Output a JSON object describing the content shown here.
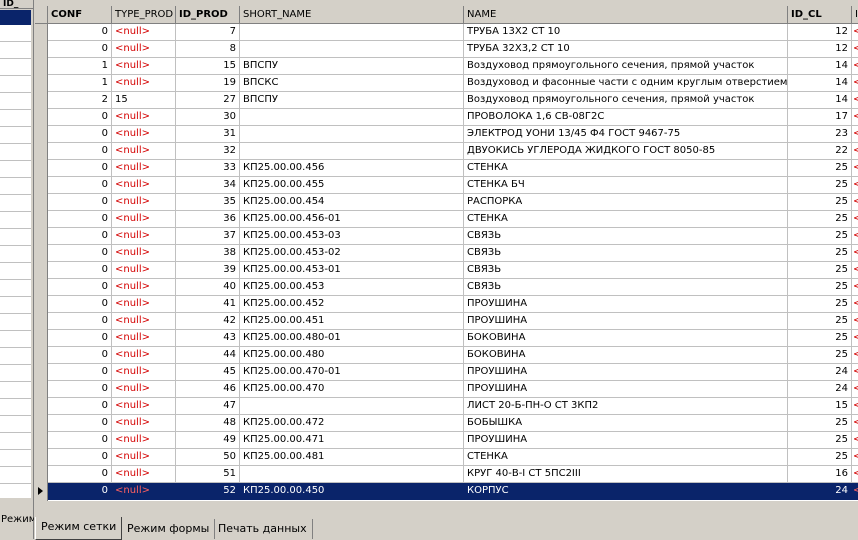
{
  "left": {
    "header": "ID_",
    "tab_label": "Режим"
  },
  "columns": [
    {
      "key": "conf",
      "label": "CONF",
      "bold": true
    },
    {
      "key": "type_prod",
      "label": "TYPE_PROD",
      "bold": false
    },
    {
      "key": "id_prod",
      "label": "ID_PROD",
      "bold": true
    },
    {
      "key": "short_name",
      "label": "SHORT_NAME",
      "bold": false
    },
    {
      "key": "name",
      "label": "NAME",
      "bold": false
    },
    {
      "key": "id_cl",
      "label": "ID_CL",
      "bold": true
    },
    {
      "key": "extra",
      "label": "I",
      "bold": false
    }
  ],
  "null_text": "<null>",
  "rows": [
    {
      "conf": "0",
      "type_prod": null,
      "id_prod": "7",
      "short_name": "",
      "name": "ТРУБА 13Х2 СТ 10",
      "id_cl": "12"
    },
    {
      "conf": "0",
      "type_prod": null,
      "id_prod": "8",
      "short_name": "",
      "name": "ТРУБА 32Х3,2 СТ 10",
      "id_cl": "12"
    },
    {
      "conf": "1",
      "type_prod": null,
      "id_prod": "15",
      "short_name": "ВПСПУ",
      "name": "Воздуховод прямоугольного сечения, прямой участок",
      "id_cl": "14"
    },
    {
      "conf": "1",
      "type_prod": null,
      "id_prod": "19",
      "short_name": "ВПСКС",
      "name": "Воздуховод и фасонные части с одним круглым отверстием",
      "id_cl": "14"
    },
    {
      "conf": "2",
      "type_prod": "15",
      "id_prod": "27",
      "short_name": "ВПСПУ",
      "name": "Воздуховод прямоугольного сечения, прямой участок",
      "id_cl": "14"
    },
    {
      "conf": "0",
      "type_prod": null,
      "id_prod": "30",
      "short_name": "",
      "name": "ПРОВОЛОКА 1,6 СВ-08Г2С",
      "id_cl": "17"
    },
    {
      "conf": "0",
      "type_prod": null,
      "id_prod": "31",
      "short_name": "",
      "name": "ЭЛЕКТРОД УОНИ 13/45 Ф4 ГОСТ 9467-75",
      "id_cl": "23"
    },
    {
      "conf": "0",
      "type_prod": null,
      "id_prod": "32",
      "short_name": "",
      "name": "ДВУОКИСЬ УГЛЕРОДА ЖИДКОГО ГОСТ 8050-85",
      "id_cl": "22"
    },
    {
      "conf": "0",
      "type_prod": null,
      "id_prod": "33",
      "short_name": "КП25.00.00.456",
      "name": "СТЕНКА",
      "id_cl": "25"
    },
    {
      "conf": "0",
      "type_prod": null,
      "id_prod": "34",
      "short_name": "КП25.00.00.455",
      "name": "СТЕНКА БЧ",
      "id_cl": "25"
    },
    {
      "conf": "0",
      "type_prod": null,
      "id_prod": "35",
      "short_name": "КП25.00.00.454",
      "name": "РАСПОРКА",
      "id_cl": "25"
    },
    {
      "conf": "0",
      "type_prod": null,
      "id_prod": "36",
      "short_name": "КП25.00.00.456-01",
      "name": "СТЕНКА",
      "id_cl": "25"
    },
    {
      "conf": "0",
      "type_prod": null,
      "id_prod": "37",
      "short_name": "КП25.00.00.453-03",
      "name": "СВЯЗЬ",
      "id_cl": "25"
    },
    {
      "conf": "0",
      "type_prod": null,
      "id_prod": "38",
      "short_name": "КП25.00.00.453-02",
      "name": "СВЯЗЬ",
      "id_cl": "25"
    },
    {
      "conf": "0",
      "type_prod": null,
      "id_prod": "39",
      "short_name": "КП25.00.00.453-01",
      "name": "СВЯЗЬ",
      "id_cl": "25"
    },
    {
      "conf": "0",
      "type_prod": null,
      "id_prod": "40",
      "short_name": "КП25.00.00.453",
      "name": "СВЯЗЬ",
      "id_cl": "25"
    },
    {
      "conf": "0",
      "type_prod": null,
      "id_prod": "41",
      "short_name": "КП25.00.00.452",
      "name": "ПРОУШИНА",
      "id_cl": "25"
    },
    {
      "conf": "0",
      "type_prod": null,
      "id_prod": "42",
      "short_name": "КП25.00.00.451",
      "name": "ПРОУШИНА",
      "id_cl": "25"
    },
    {
      "conf": "0",
      "type_prod": null,
      "id_prod": "43",
      "short_name": "КП25.00.00.480-01",
      "name": "БОКОВИНА",
      "id_cl": "25"
    },
    {
      "conf": "0",
      "type_prod": null,
      "id_prod": "44",
      "short_name": "КП25.00.00.480",
      "name": "БОКОВИНА",
      "id_cl": "25"
    },
    {
      "conf": "0",
      "type_prod": null,
      "id_prod": "45",
      "short_name": "КП25.00.00.470-01",
      "name": "ПРОУШИНА",
      "id_cl": "24"
    },
    {
      "conf": "0",
      "type_prod": null,
      "id_prod": "46",
      "short_name": "КП25.00.00.470",
      "name": "ПРОУШИНА",
      "id_cl": "24"
    },
    {
      "conf": "0",
      "type_prod": null,
      "id_prod": "47",
      "short_name": "",
      "name": "ЛИСТ 20-Б-ПН-О СТ 3КП2",
      "id_cl": "15"
    },
    {
      "conf": "0",
      "type_prod": null,
      "id_prod": "48",
      "short_name": "КП25.00.00.472",
      "name": "БОБЫШКА",
      "id_cl": "25"
    },
    {
      "conf": "0",
      "type_prod": null,
      "id_prod": "49",
      "short_name": "КП25.00.00.471",
      "name": "ПРОУШИНА",
      "id_cl": "25"
    },
    {
      "conf": "0",
      "type_prod": null,
      "id_prod": "50",
      "short_name": "КП25.00.00.481",
      "name": "СТЕНКА",
      "id_cl": "25"
    },
    {
      "conf": "0",
      "type_prod": null,
      "id_prod": "51",
      "short_name": "",
      "name": "КРУГ 40-В-I СТ 5ПС2III",
      "id_cl": "16"
    },
    {
      "conf": "0",
      "type_prod": null,
      "id_prod": "52",
      "short_name": "КП25.00.00.450",
      "name": "КОРПУС",
      "id_cl": "24",
      "selected": true
    }
  ],
  "tabs": [
    {
      "label": "Режим сетки",
      "active": true
    },
    {
      "label": "Режим формы",
      "active": false
    },
    {
      "label": "Печать данных",
      "active": false
    }
  ],
  "colors": {
    "null": "#d40000",
    "selection": "#0a246a",
    "chrome": "#d4d0c8"
  }
}
